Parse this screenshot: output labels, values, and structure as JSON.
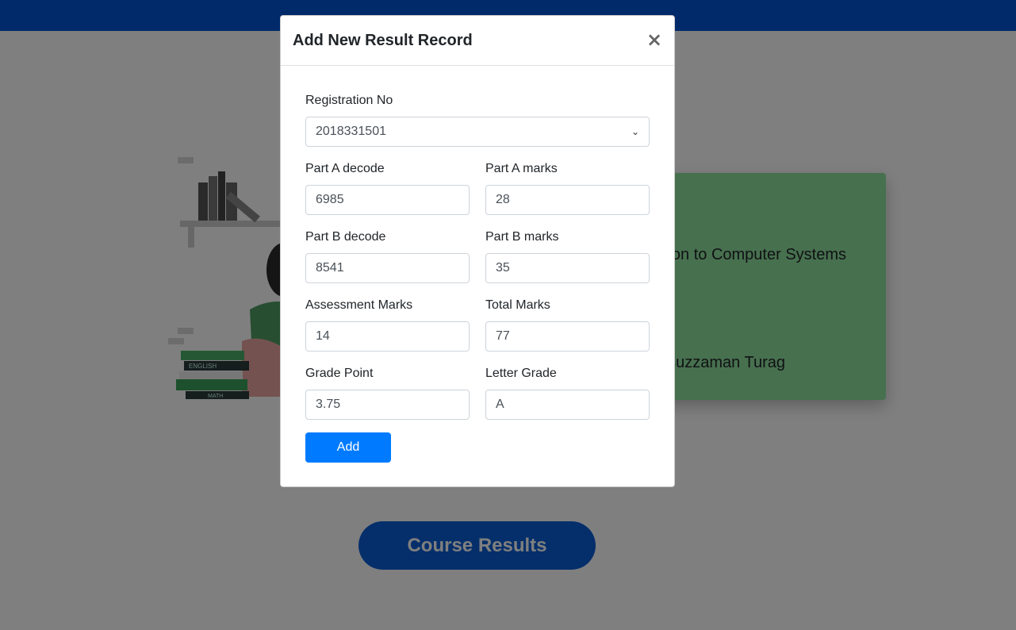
{
  "background": {
    "course_title_partial": "on to Computer Systems",
    "teacher_partial": "suzzaman Turag",
    "course_results_button": "Course Results",
    "book_labels": [
      "ENGLISH",
      "MATH"
    ]
  },
  "modal": {
    "title": "Add New Result Record",
    "close_label": "×",
    "registration": {
      "label": "Registration No",
      "value": "2018331501"
    },
    "part_a_decode": {
      "label": "Part A decode",
      "value": "6985"
    },
    "part_a_marks": {
      "label": "Part A marks",
      "value": "28"
    },
    "part_b_decode": {
      "label": "Part B decode",
      "value": "8541"
    },
    "part_b_marks": {
      "label": "Part B marks",
      "value": "35"
    },
    "assessment_marks": {
      "label": "Assessment Marks",
      "value": "14"
    },
    "total_marks": {
      "label": "Total Marks",
      "value": "77"
    },
    "grade_point": {
      "label": "Grade Point",
      "value": "3.75"
    },
    "letter_grade": {
      "label": "Letter Grade",
      "value": "A"
    },
    "add_button": "Add"
  },
  "colors": {
    "navbar": "#0055d4",
    "card": "#8ee09e",
    "primary_button": "#007bff",
    "course_results_button": "#0a5fd6"
  }
}
